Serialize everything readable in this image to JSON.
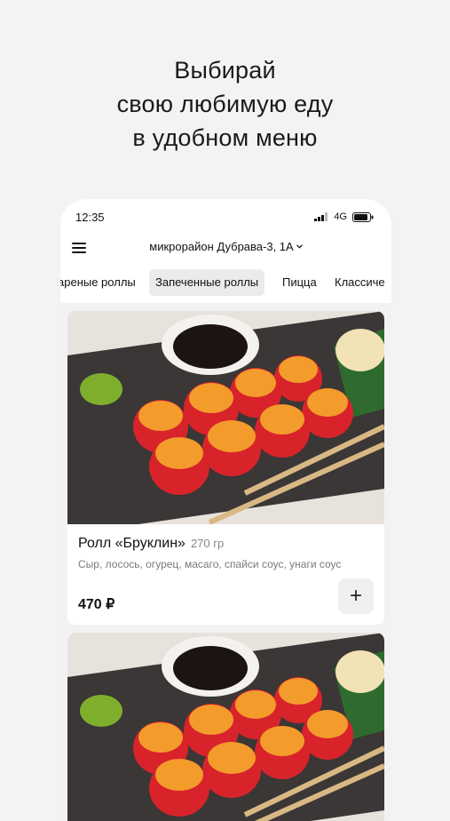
{
  "promo": {
    "line1": "Выбирай",
    "line2": "свою любимую еду",
    "line3": "в удобном меню"
  },
  "status_bar": {
    "time": "12:35",
    "network": "4G"
  },
  "header": {
    "address": "микрорайон Дубрава-3, 1А"
  },
  "tabs": [
    {
      "label": "Жареные роллы",
      "visible_text": "ареные роллы"
    },
    {
      "label": "Запеченные роллы",
      "visible_text": "Запеченные роллы",
      "active": true
    },
    {
      "label": "Пицца",
      "visible_text": "Пицца"
    },
    {
      "label": "Классические",
      "visible_text": "Классиче"
    }
  ],
  "menu_items": [
    {
      "name": "Ролл «Бруклин»",
      "weight": "270 гр",
      "description": "Сыр, лосось, огурец, масаго, спайси соус, унаги соус",
      "price": "470 ₽",
      "add_label": "+"
    }
  ],
  "colors": {
    "background": "#f3f3f3",
    "card": "#ffffff",
    "tab_active": "#ebebeb"
  }
}
